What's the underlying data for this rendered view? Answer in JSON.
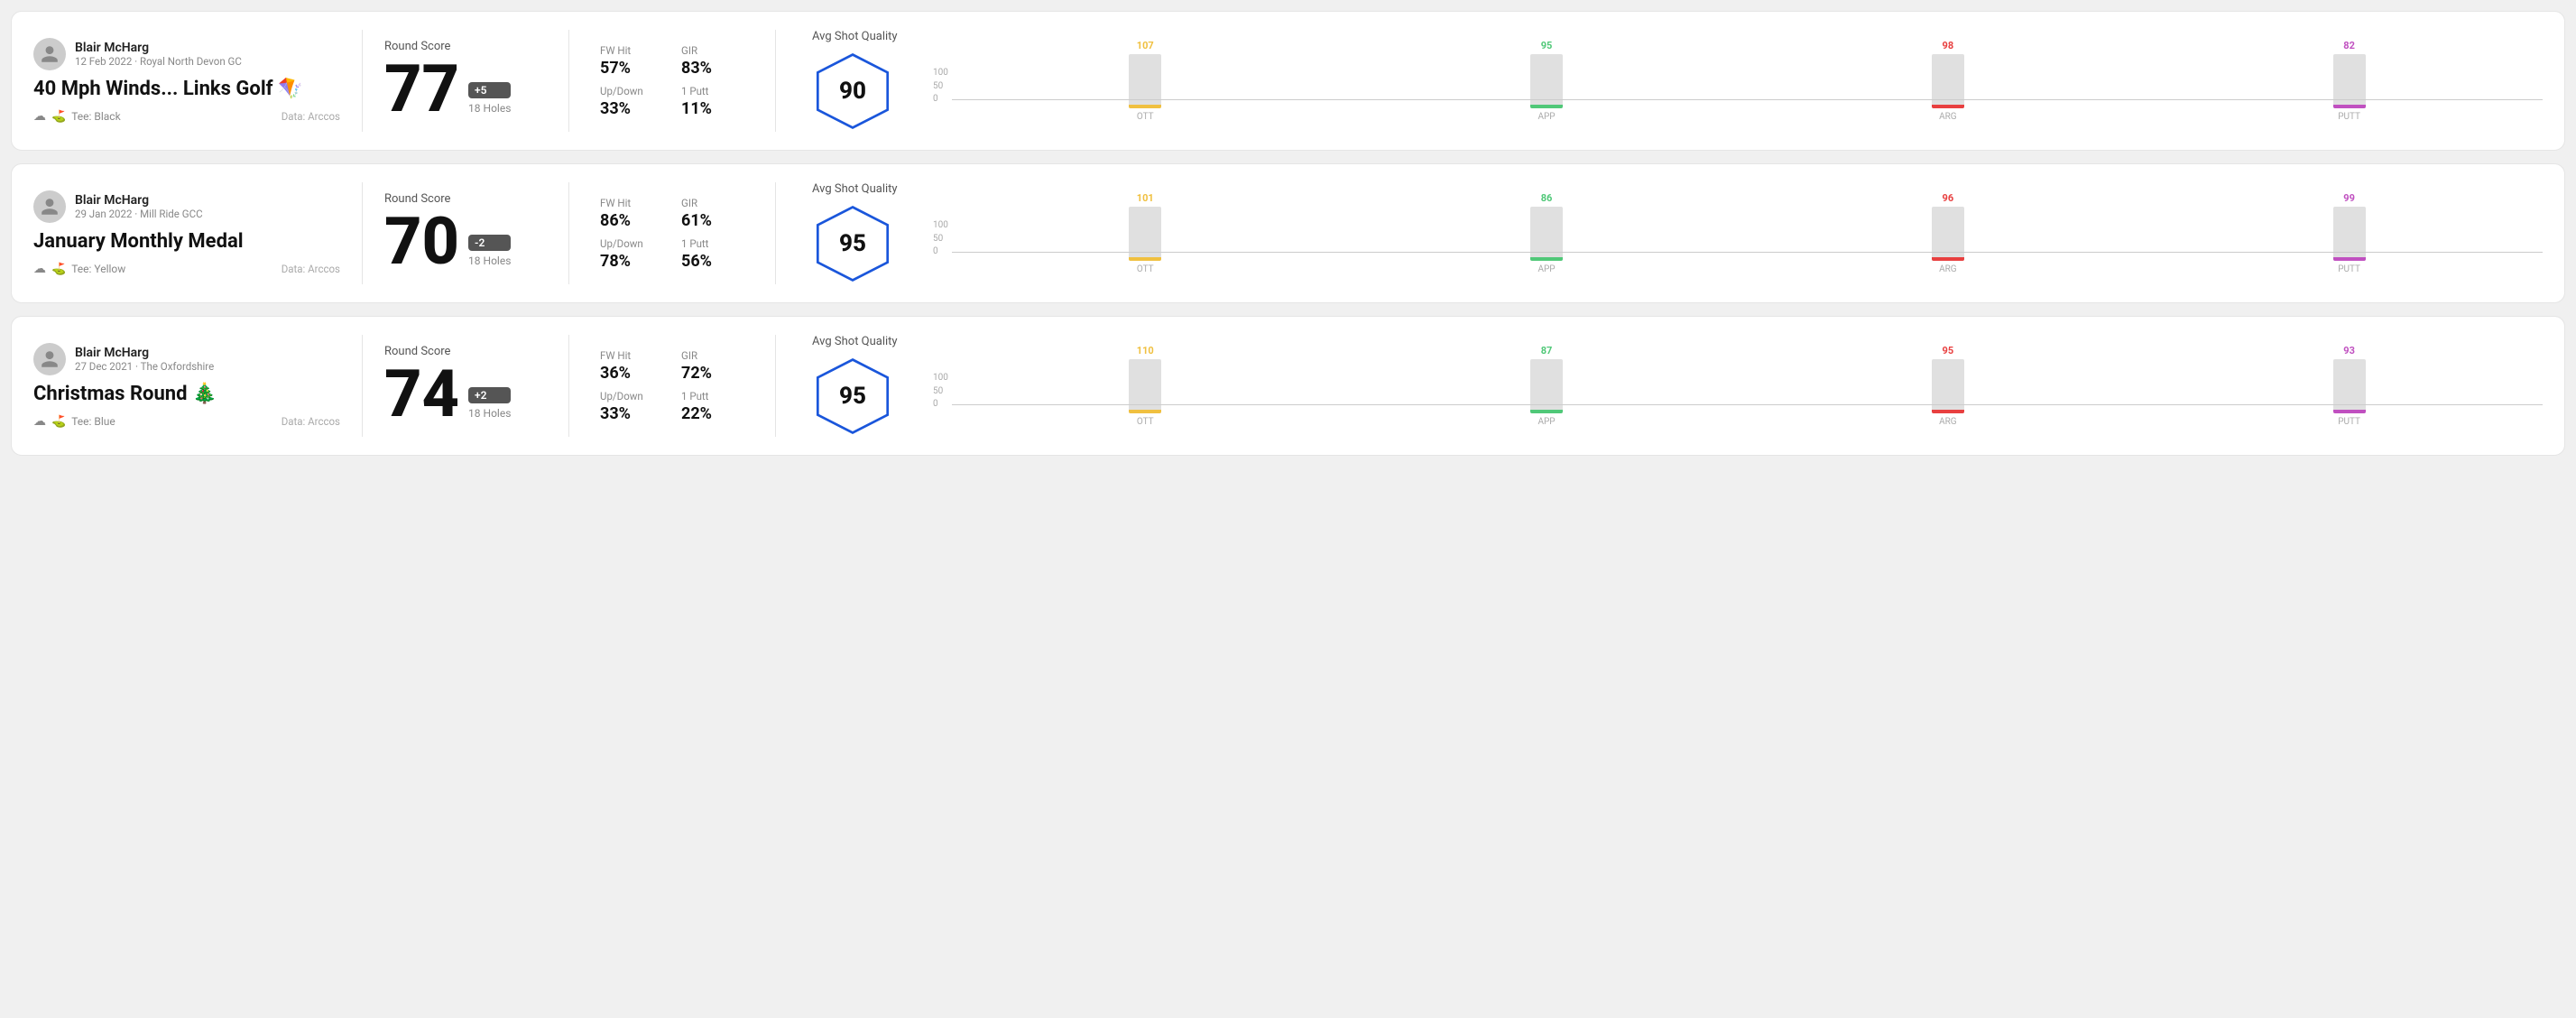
{
  "rounds": [
    {
      "id": "round-1",
      "player": "Blair McHarg",
      "date": "12 Feb 2022 · Royal North Devon GC",
      "title": "40 Mph Winds... Links Golf",
      "title_emoji": "🪁",
      "tee": "Black",
      "data_source": "Data: Arccos",
      "round_score_label": "Round Score",
      "score": "77",
      "badge": "+5",
      "holes": "18 Holes",
      "fw_hit_label": "FW Hit",
      "fw_hit": "57%",
      "gir_label": "GIR",
      "gir": "83%",
      "updown_label": "Up/Down",
      "updown": "33%",
      "one_putt_label": "1 Putt",
      "one_putt": "11%",
      "avg_quality_label": "Avg Shot Quality",
      "quality_score": "90",
      "bars": [
        {
          "label": "OTT",
          "value": 107,
          "color": "#f0c040"
        },
        {
          "label": "APP",
          "value": 95,
          "color": "#50c878"
        },
        {
          "label": "ARG",
          "value": 98,
          "color": "#e84040"
        },
        {
          "label": "PUTT",
          "value": 82,
          "color": "#c050c0"
        }
      ]
    },
    {
      "id": "round-2",
      "player": "Blair McHarg",
      "date": "29 Jan 2022 · Mill Ride GCC",
      "title": "January Monthly Medal",
      "title_emoji": "",
      "tee": "Yellow",
      "data_source": "Data: Arccos",
      "round_score_label": "Round Score",
      "score": "70",
      "badge": "-2",
      "holes": "18 Holes",
      "fw_hit_label": "FW Hit",
      "fw_hit": "86%",
      "gir_label": "GIR",
      "gir": "61%",
      "updown_label": "Up/Down",
      "updown": "78%",
      "one_putt_label": "1 Putt",
      "one_putt": "56%",
      "avg_quality_label": "Avg Shot Quality",
      "quality_score": "95",
      "bars": [
        {
          "label": "OTT",
          "value": 101,
          "color": "#f0c040"
        },
        {
          "label": "APP",
          "value": 86,
          "color": "#50c878"
        },
        {
          "label": "ARG",
          "value": 96,
          "color": "#e84040"
        },
        {
          "label": "PUTT",
          "value": 99,
          "color": "#c050c0"
        }
      ]
    },
    {
      "id": "round-3",
      "player": "Blair McHarg",
      "date": "27 Dec 2021 · The Oxfordshire",
      "title": "Christmas Round",
      "title_emoji": "🎄",
      "tee": "Blue",
      "data_source": "Data: Arccos",
      "round_score_label": "Round Score",
      "score": "74",
      "badge": "+2",
      "holes": "18 Holes",
      "fw_hit_label": "FW Hit",
      "fw_hit": "36%",
      "gir_label": "GIR",
      "gir": "72%",
      "updown_label": "Up/Down",
      "updown": "33%",
      "one_putt_label": "1 Putt",
      "one_putt": "22%",
      "avg_quality_label": "Avg Shot Quality",
      "quality_score": "95",
      "bars": [
        {
          "label": "OTT",
          "value": 110,
          "color": "#f0c040"
        },
        {
          "label": "APP",
          "value": 87,
          "color": "#50c878"
        },
        {
          "label": "ARG",
          "value": 95,
          "color": "#e84040"
        },
        {
          "label": "PUTT",
          "value": 93,
          "color": "#c050c0"
        }
      ]
    }
  ]
}
